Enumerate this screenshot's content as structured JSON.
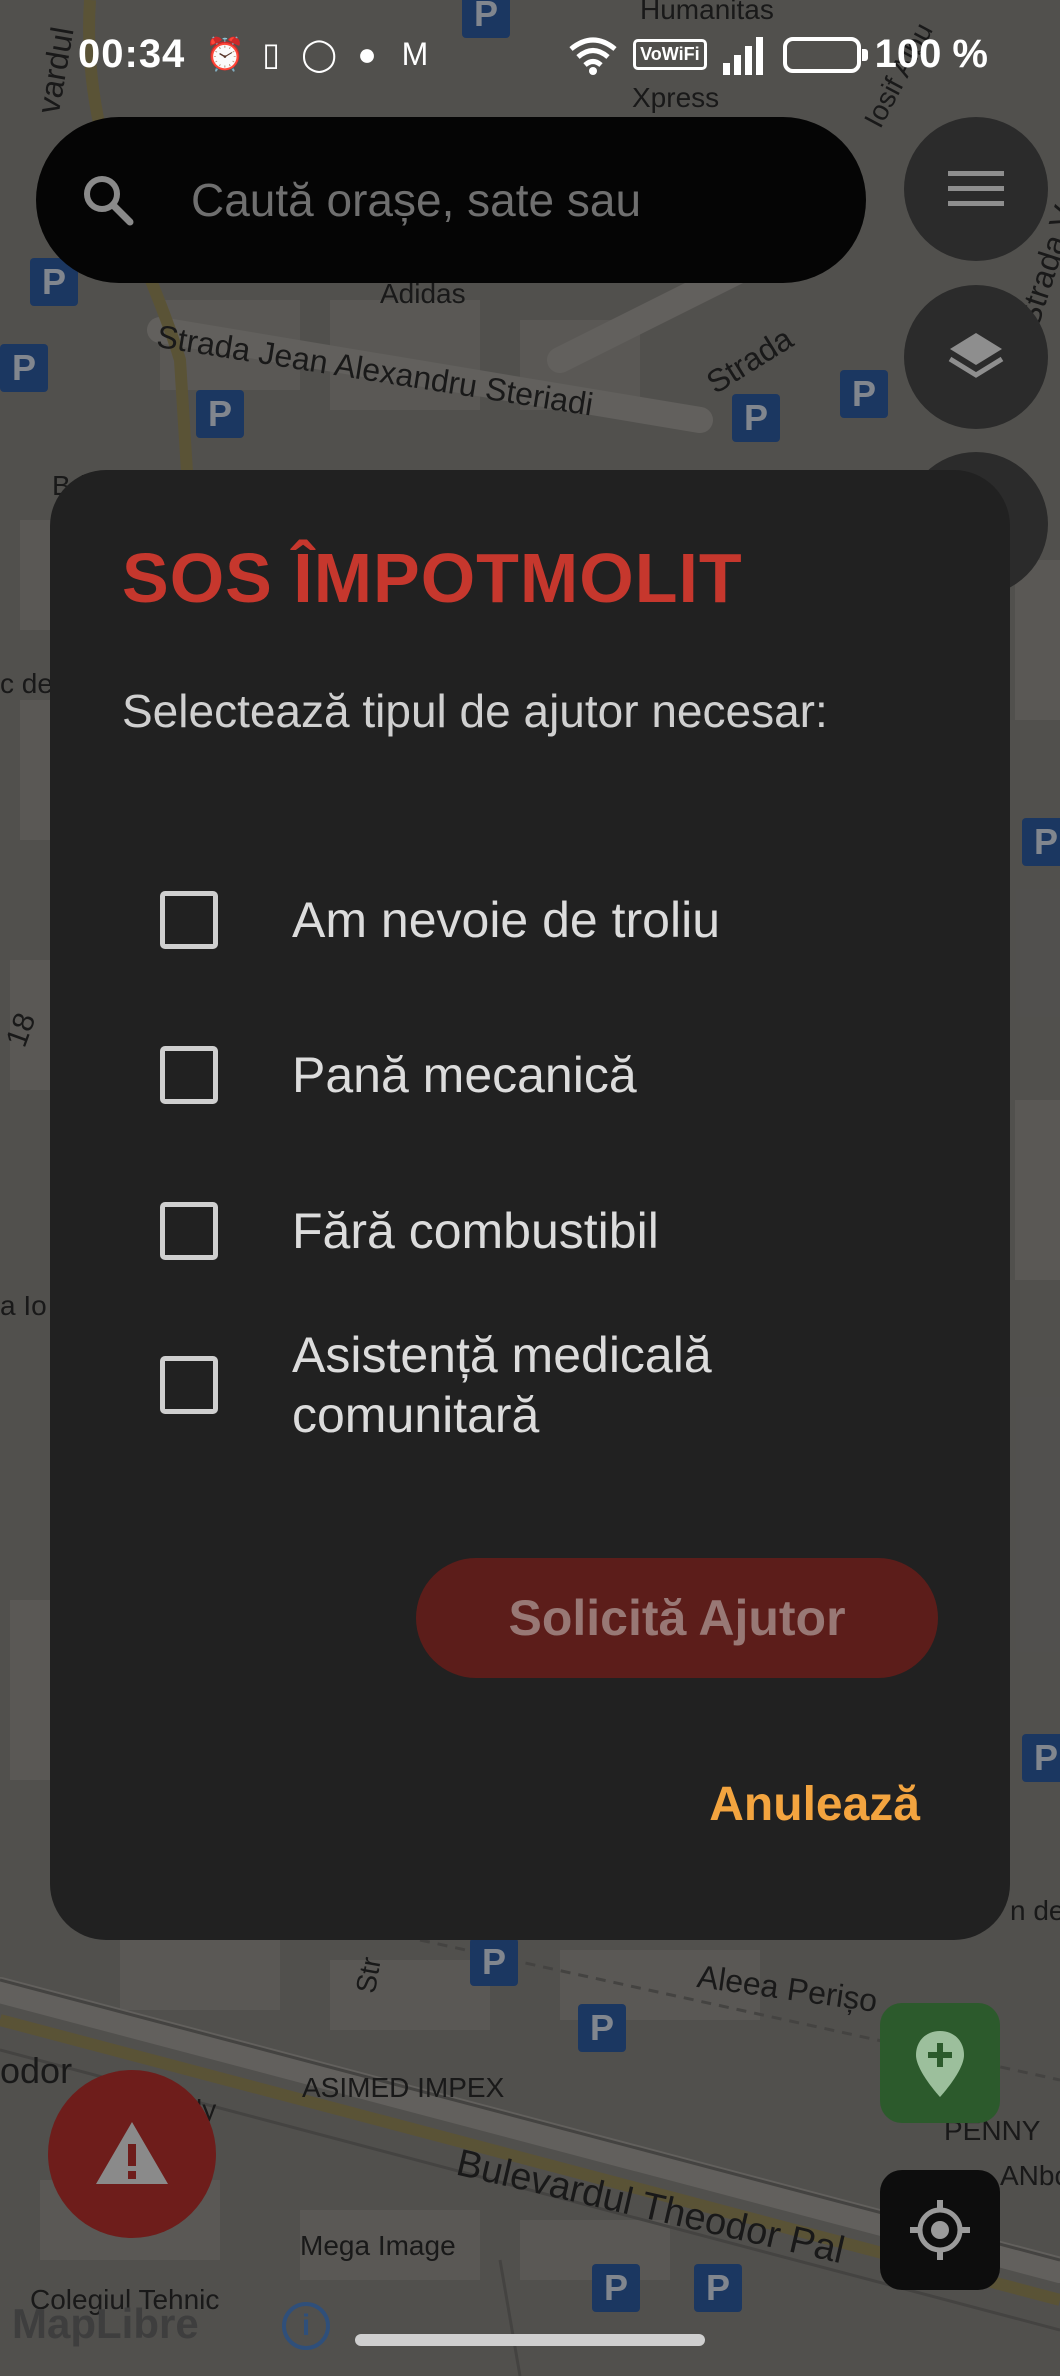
{
  "status_bar": {
    "time": "00:34",
    "notification_icons": [
      "alarm-icon",
      "vibrate-icon",
      "whatsapp-icon",
      "app-icon",
      "gmail-icon"
    ],
    "vowifi": "VoWiFi",
    "battery_percent": "100 %"
  },
  "search": {
    "placeholder": "Caută orașe, sate sau"
  },
  "map": {
    "labels": [
      "Humanitas",
      "Xpress",
      "Iosif Albu",
      "Adidas",
      "Strada Jean Alexandru Steriadi",
      "Strada",
      "Strada V",
      "Aleea Perișo",
      "ASIMED IMPEX",
      "Bulevardul Theodor Pal",
      "Mega Image",
      "Colegiul Tehnic",
      "PENNY",
      "ANbo",
      "n de",
      "Str",
      "vardul",
      "odor",
      "ly",
      "Bd",
      "c de",
      "18",
      "a Io"
    ],
    "parking": "P",
    "attribution": "MapLibre"
  },
  "dialog": {
    "title": "SOS ÎMPOTMOLIT",
    "subtitle": "Selectează tipul de ajutor necesar:",
    "options": [
      {
        "label": "Am nevoie de troliu",
        "checked": false
      },
      {
        "label": "Pană mecanică",
        "checked": false
      },
      {
        "label": "Fără combustibil",
        "checked": false
      },
      {
        "label": "Asistență medicală comunitară",
        "checked": false
      }
    ],
    "submit_label": "Solicită Ajutor",
    "cancel_label": "Anulează"
  },
  "colors": {
    "title_red": "#c6372d",
    "cancel_orange": "#f3a43f",
    "dialog_bg": "#212121",
    "submit_disabled_bg": "#5c1d1a"
  }
}
